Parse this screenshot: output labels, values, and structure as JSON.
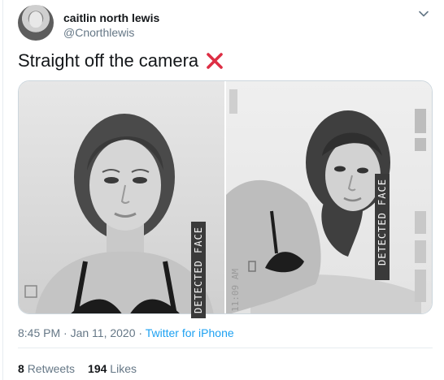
{
  "tweet": {
    "author": {
      "display_name": "caitlin north lewis",
      "handle": "@Cnorthlewis",
      "avatar_icon": "profile-photo"
    },
    "text": "Straight off the camera",
    "emoji": "cross-mark",
    "emoji_color": "#dd2e44",
    "media": {
      "photos": [
        {
          "overlay_label": "DETECTED FACE"
        },
        {
          "overlay_label": "DETECTED FACE",
          "side_text": "11:09 AM"
        }
      ]
    },
    "meta": {
      "timestamp": "8:45 PM · Jan 11, 2020",
      "separator": " · ",
      "source": "Twitter for iPhone"
    },
    "stats": {
      "retweets_count": "8",
      "retweets_label": "Retweets",
      "likes_count": "194",
      "likes_label": "Likes"
    }
  },
  "colors": {
    "link": "#1da1f2",
    "secondary_text": "#657786",
    "primary_text": "#14171a",
    "border": "#e6ecf0"
  }
}
